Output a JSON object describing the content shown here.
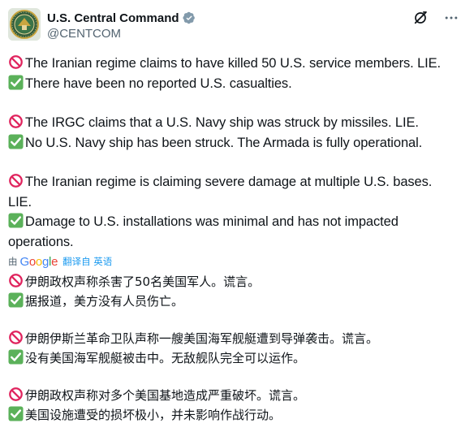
{
  "account": {
    "display_name": "U.S. Central Command",
    "handle": "@CENTCOM",
    "avatar_icon": "centcom-seal-icon",
    "verified_color": "#829aab"
  },
  "actions": {
    "grok_icon": "grok-icon",
    "more_icon": "more-icon"
  },
  "colors": {
    "prohibited": "#e0245e",
    "check": "#5bb15a",
    "link": "#1d9bf0",
    "secondary_text": "#536471"
  },
  "post_en": [
    {
      "emoji": "prohibited-icon",
      "text": "The Iranian regime claims to have killed 50 U.S. service members. LIE."
    },
    {
      "emoji": "check-icon",
      "text": "There have been no reported U.S. casualties."
    },
    {
      "emoji": "prohibited-icon",
      "text": "The IRGC claims that a U.S. Navy ship was struck by missiles. LIE."
    },
    {
      "emoji": "check-icon",
      "text": "No U.S. Navy ship has been struck. The Armada is fully operational."
    },
    {
      "emoji": "prohibited-icon",
      "text": "The Iranian regime is claiming severe damage at multiple U.S. bases."
    },
    {
      "text": "LIE."
    },
    {
      "emoji": "check-icon",
      "text": "Damage to U.S. installations was minimal and has not impacted"
    },
    {
      "text": "operations."
    }
  ],
  "translation": {
    "by": "由",
    "provider_logo": "Google",
    "action_label": "翻译自 英语"
  },
  "post_cn": [
    {
      "emoji": "prohibited-icon",
      "text": "伊朗政权声称杀害了50名美国军人。谎言。"
    },
    {
      "emoji": "check-icon",
      "text": "据报道，美方没有人员伤亡。"
    },
    {
      "emoji": "prohibited-icon",
      "text": "伊朗伊斯兰革命卫队声称一艘美国海军舰艇遭到导弹袭击。谎言。"
    },
    {
      "emoji": "check-icon",
      "text": "没有美国海军舰艇被击中。无敌舰队完全可以运作。"
    },
    {
      "emoji": "prohibited-icon",
      "text": "伊朗政权声称对多个美国基地造成严重破坏。谎言。"
    },
    {
      "emoji": "check-icon",
      "text": "美国设施遭受的损坏极小，并未影响作战行动。"
    }
  ]
}
